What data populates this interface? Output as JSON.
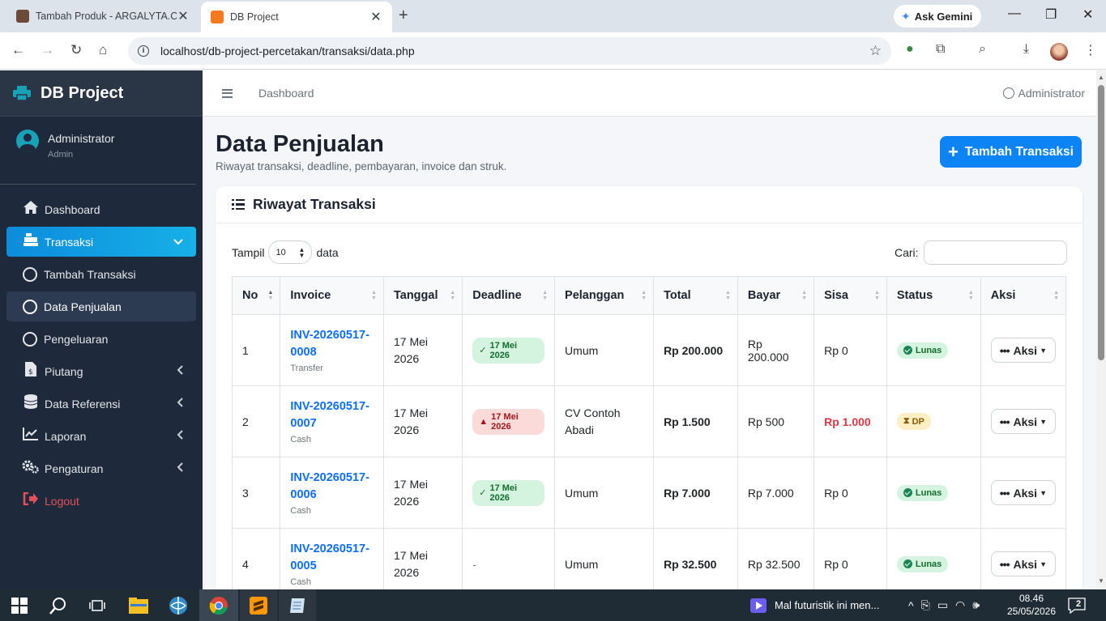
{
  "browser": {
    "tabs": [
      {
        "title": "Tambah Produk - ARGALYTA.CO"
      },
      {
        "title": "DB Project"
      }
    ],
    "url": "localhost/db-project-percetakan/transaksi/data.php",
    "gemini_label": "Ask Gemini"
  },
  "sidebar": {
    "brand": "DB Project",
    "user_name": "Administrator",
    "user_role": "Admin",
    "items": [
      {
        "label": "Dashboard",
        "icon": "home-icon"
      },
      {
        "label": "Transaksi",
        "icon": "cash-register-icon"
      },
      {
        "label": "Tambah Transaksi",
        "icon": "circle-icon"
      },
      {
        "label": "Data Penjualan",
        "icon": "circle-icon"
      },
      {
        "label": "Pengeluaran",
        "icon": "circle-icon"
      },
      {
        "label": "Piutang",
        "icon": "invoice-dollar-icon"
      },
      {
        "label": "Data Referensi",
        "icon": "database-icon"
      },
      {
        "label": "Laporan",
        "icon": "chart-line-icon"
      },
      {
        "label": "Pengaturan",
        "icon": "cogs-icon"
      },
      {
        "label": "Logout",
        "icon": "sign-out-icon"
      }
    ]
  },
  "topnav": {
    "breadcrumb": "Dashboard",
    "user": "Administrator"
  },
  "page": {
    "title": "Data Penjualan",
    "subtitle": "Riwayat transaksi, deadline, pembayaran, invoice dan struk.",
    "add_button": "Tambah Transaksi",
    "card_title": "Riwayat Transaksi",
    "show_prefix": "Tampil",
    "show_value": "10",
    "show_suffix": "data",
    "search_label": "Cari:"
  },
  "table": {
    "headers": [
      "No",
      "Invoice",
      "Tanggal",
      "Deadline",
      "Pelanggan",
      "Total",
      "Bayar",
      "Sisa",
      "Status",
      "Aksi"
    ],
    "rows": [
      {
        "no": "1",
        "invoice_a": "INV-20260517-",
        "invoice_b": "0008",
        "method": "Transfer",
        "date_a": "17 Mei",
        "date_b": "2026",
        "deadline": "17 Mei 2026",
        "deadline_state": "ok",
        "customer_a": "Umum",
        "customer_b": "",
        "total": "Rp 200.000",
        "paid": "Rp 200.000",
        "remaining": "Rp 0",
        "status": "Lunas",
        "action": "Aksi"
      },
      {
        "no": "2",
        "invoice_a": "INV-20260517-",
        "invoice_b": "0007",
        "method": "Cash",
        "date_a": "17 Mei",
        "date_b": "2026",
        "deadline": "17 Mei 2026",
        "deadline_state": "late",
        "customer_a": "CV Contoh",
        "customer_b": "Abadi",
        "total": "Rp 1.500",
        "paid": "Rp 500",
        "remaining": "Rp 1.000",
        "status": "DP",
        "action": "Aksi"
      },
      {
        "no": "3",
        "invoice_a": "INV-20260517-",
        "invoice_b": "0006",
        "method": "Cash",
        "date_a": "17 Mei",
        "date_b": "2026",
        "deadline": "17 Mei 2026",
        "deadline_state": "ok",
        "customer_a": "Umum",
        "customer_b": "",
        "total": "Rp 7.000",
        "paid": "Rp 7.000",
        "remaining": "Rp 0",
        "status": "Lunas",
        "action": "Aksi"
      },
      {
        "no": "4",
        "invoice_a": "INV-20260517-",
        "invoice_b": "0005",
        "method": "Cash",
        "date_a": "17 Mei",
        "date_b": "2026",
        "deadline": "-",
        "deadline_state": "none",
        "customer_a": "Umum",
        "customer_b": "",
        "total": "Rp 32.500",
        "paid": "Rp 32.500",
        "remaining": "Rp 0",
        "status": "Lunas",
        "action": "Aksi"
      }
    ]
  },
  "taskbar": {
    "media": "Mal futuristik ini men...",
    "time": "08.46",
    "date": "25/05/2026",
    "notifications": "2"
  },
  "colors": {
    "sidebar_bg": "#1e2a3b",
    "accent": "#0d84f6",
    "link": "#0d6efd",
    "danger": "#dc3545"
  }
}
